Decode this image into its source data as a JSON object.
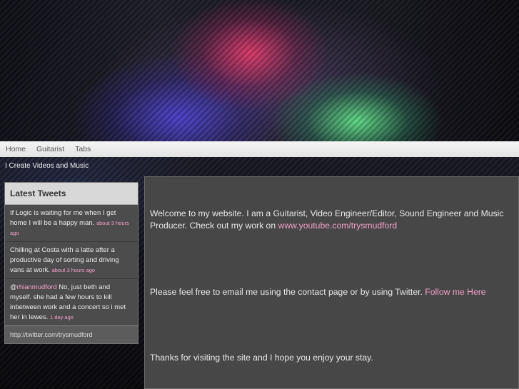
{
  "nav": {
    "items": [
      "Home",
      "Guitarist",
      "Tabs"
    ]
  },
  "tagline": "I Create Videos and Music",
  "tweets": {
    "title": "Latest Tweets",
    "items": [
      {
        "text": "If Logic is waiting for me when I get home I will be a happy man.",
        "time": "about 3 hours ago"
      },
      {
        "text": "Chilling at Costa with a latte after a productive day of sorting and driving vans at work.",
        "time": "about 3 hours ago"
      },
      {
        "mention": "rhianmudford",
        "text": " No, just beth and myself. she had a few hours to kill inbetween work and a concert so i met her in lewes.",
        "time": "1 day ago"
      }
    ],
    "footer": "http://twitter.com/trysmudford"
  },
  "main": {
    "p1_text": "Welcome to my website. I am a Guitarist, Video Engineer/Editor, Sound Engineer and Music Producer. Check out my work on ",
    "p1_link": "www.youtube.com/trysmudford",
    "p2_text": "Please feel free to email me using the contact page or by using Twitter. ",
    "p2_link": "Follow me Here",
    "p3_text": "Thanks for visiting the site and I hope you enjoy your stay."
  },
  "colors": {
    "link": "#f2a0c8",
    "content_bg": "#474747",
    "nav_bg": "#eeeeee"
  }
}
